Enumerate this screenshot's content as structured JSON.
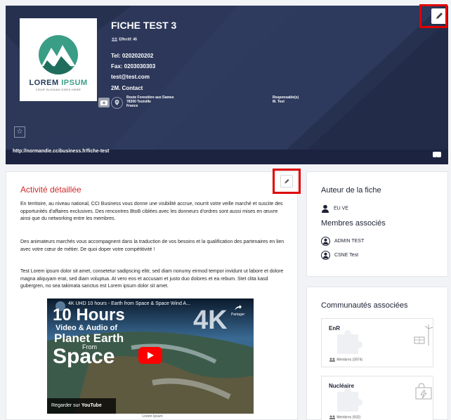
{
  "header": {
    "title": "FICHE TEST 3",
    "effectif": "Effectif: 45",
    "tel": "Tel: 0202020202",
    "fax": "Fax: 0203030303",
    "email": "test@test.com",
    "contact": "2M. Contact",
    "address_lines": [
      "Route Forestière aux Dames",
      "78300 Testville",
      "France"
    ],
    "responsable_label": "Responsable(s)",
    "responsable_value": "M. Test",
    "url": "http://normandie.ccibusiness.fr/fiche-test",
    "logo_title_main": "LOREM ",
    "logo_title_accent": "IPSUM",
    "logo_slogan": "YOUR SLOGAN GOES HERE"
  },
  "activity": {
    "title": "Activité détaillée",
    "paragraphs": [
      "En territoire, au niveau national, CCI Business vous donne une visibilité accrue, nourrit votre veille marché et suscite des opportunités d'affaires exclusives. Des rencontres BtoB ciblées avec les donneurs d'ordres sont aussi mises en œuvre ainsi que du networking entre les membres.",
      "Des animateurs marchés vous accompagnent dans la traduction de vos besoins et la qualification des partenaires en lien avec votre cœur de métier. De quoi doper votre compétitivité !",
      "Test Lorem ipsum dolor sit amet, consetetur sadipscing elitr, sed diam nonumy eirmod tempor invidunt ut labore et dolore magna aliquyam erat, sed diam voluptua. At vero eos et accusam et justo duo dolores et ea rebum. Stet clita kasd gubergren, no sea takimata sanctus est Lorem ipsum dolor sit amet."
    ],
    "video": {
      "title": "4K UHD 10 hours - Earth from Space & Space Wind A...",
      "share": "Partager",
      "line1": "10 Hours",
      "line2": "Video & Audio of",
      "line3": "Planet Earth",
      "line4": "From",
      "line5": "Space",
      "badge": "4K",
      "watch_on": "Regarder sur",
      "youtube": "YouTube"
    },
    "caption": "Lorem Ipsum"
  },
  "author": {
    "title": "Auteur de la fiche",
    "name": "EU VE",
    "members_title": "Membres associés",
    "members": [
      "ADMIN TEST",
      "CSNE Test"
    ]
  },
  "communities": {
    "title": "Communautés associées",
    "items": [
      {
        "name": "EnR",
        "members": "Membres (3974)"
      },
      {
        "name": "Nucléaire",
        "members": "Membres (932)"
      }
    ]
  },
  "colors": {
    "banner": "#26304f",
    "accent_red": "#d02929",
    "logo_green": "#3a9e86"
  }
}
